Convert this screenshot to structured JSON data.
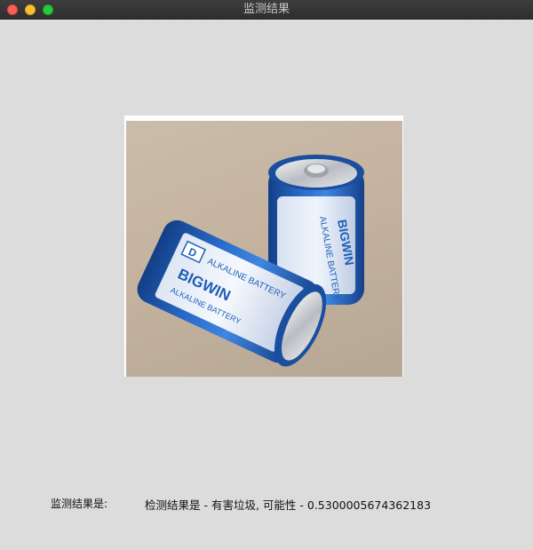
{
  "window": {
    "title": "监测结果"
  },
  "image": {
    "subject": "two D-size alkaline batteries",
    "battery_brand": "BIGWIN",
    "battery_text": "ALKALINE BATTERY",
    "battery_size": "D",
    "colors": {
      "battery_blue": "#1f5fb8",
      "background": "#c3b39f"
    }
  },
  "result": {
    "label": "监测结果是:",
    "text": "检测结果是 - 有害垃圾, 可能性 - 0.5300005674362183"
  }
}
